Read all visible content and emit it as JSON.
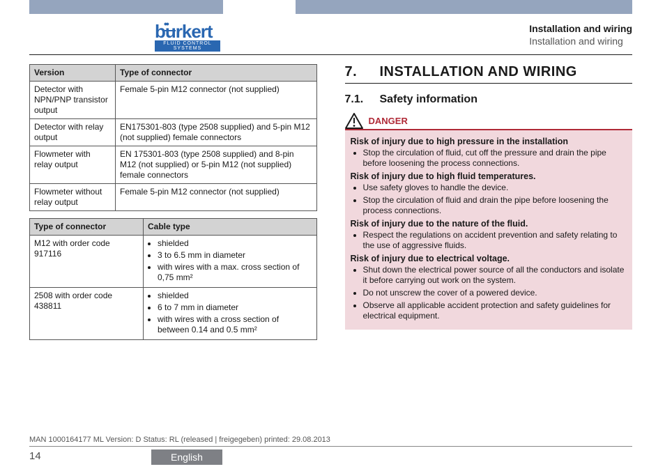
{
  "header": {
    "breadcrumb_bold": "Installation and wiring",
    "breadcrumb_light": "Installation and wiring",
    "logo_main": "burkert",
    "logo_sub": "FLUID CONTROL SYSTEMS"
  },
  "table1": {
    "headers": [
      "Version",
      "Type of connector"
    ],
    "rows": [
      [
        "Detector with NPN/PNP transistor output",
        "Female 5-pin M12 connector (not supplied)"
      ],
      [
        "Detector with relay output",
        "EN175301-803 (type 2508 supplied) and 5-pin M12 (not supplied) female connectors"
      ],
      [
        "Flowmeter with relay output",
        "EN 175301-803 (type 2508 supplied) and 8-pin M12 (not supplied) or 5-pin M12 (not supplied) female connectors"
      ],
      [
        "Flowmeter without relay output",
        "Female 5-pin M12 connector (not supplied)"
      ]
    ]
  },
  "table2": {
    "headers": [
      "Type of connector",
      "Cable type"
    ],
    "rows": [
      {
        "c1": "M12 with order code 917116",
        "items": [
          "shielded",
          "3 to 6.5 mm in diameter",
          "with wires with a max. cross section of 0,75 mm²"
        ]
      },
      {
        "c1": "2508 with order code 438811",
        "items": [
          "shielded",
          "6 to 7 mm in diameter",
          "with wires with a cross section of between 0.14 and 0.5 mm²"
        ]
      }
    ]
  },
  "section": {
    "num": "7.",
    "title": "INSTALLATION AND WIRING",
    "sub_num": "7.1.",
    "sub_title": "Safety information",
    "danger_label": "DANGER",
    "risks": [
      {
        "heading": "Risk of injury due to high pressure in the installation",
        "items": [
          "Stop the circulation of fluid, cut off the pressure and drain the pipe before loosening the process connections."
        ]
      },
      {
        "heading": "Risk of injury due to high fluid temperatures.",
        "items": [
          "Use safety gloves to handle the device.",
          "Stop the circulation of fluid and drain the pipe before loosening the process connections."
        ]
      },
      {
        "heading": "Risk of injury due to the nature of the fluid.",
        "items": [
          "Respect the regulations on accident prevention and safety relating to the use of aggressive fluids."
        ]
      },
      {
        "heading": "Risk of injury due to electrical voltage.",
        "items": [
          "Shut down the electrical power source of all the conductors and isolate it before carrying out work on the system.",
          "Do not unscrew the cover of a powered device.",
          "Observe all applicable accident protection and safety guidelines for electrical equipment."
        ]
      }
    ]
  },
  "footer": {
    "meta": "MAN  1000164177  ML  Version: D Status: RL (released | freigegeben)  printed: 29.08.2013",
    "page_num": "14",
    "language": "English"
  }
}
